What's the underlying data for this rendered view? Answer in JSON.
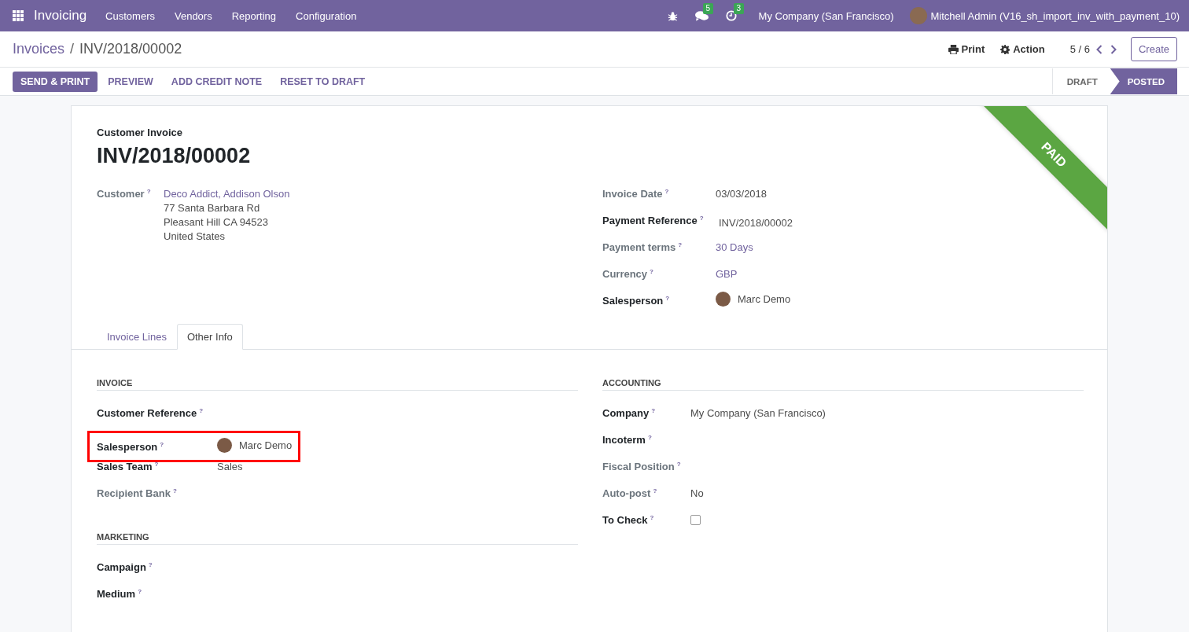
{
  "navbar": {
    "app": "Invoicing",
    "menu": [
      "Customers",
      "Vendors",
      "Reporting",
      "Configuration"
    ],
    "messages_count": "5",
    "activities_count": "3",
    "company": "My Company (San Francisco)",
    "user": "Mitchell Admin (V16_sh_import_inv_with_payment_10)"
  },
  "breadcrumb": {
    "parent": "Invoices",
    "separator": "/",
    "current": "INV/2018/00002"
  },
  "toolbar": {
    "print": "Print",
    "action": "Action",
    "pager": "5 / 6",
    "create": "Create"
  },
  "buttons": [
    {
      "label": "SEND & PRINT",
      "primary": true
    },
    {
      "label": "PREVIEW",
      "primary": false
    },
    {
      "label": "ADD CREDIT NOTE",
      "primary": false
    },
    {
      "label": "RESET TO DRAFT",
      "primary": false
    }
  ],
  "status_steps": [
    {
      "label": "DRAFT",
      "selected": false
    },
    {
      "label": "POSTED",
      "selected": true
    }
  ],
  "ribbon": "PAID",
  "form": {
    "subtitle": "Customer Invoice",
    "title": "INV/2018/00002",
    "left_fields": [
      {
        "label": "Customer",
        "help": "?",
        "required": false,
        "kind": "partner",
        "value": "Deco Addict, Addison Olson",
        "address": [
          "77 Santa Barbara Rd",
          "Pleasant Hill CA 94523",
          "United States"
        ]
      }
    ],
    "right_fields": [
      {
        "label": "Invoice Date",
        "help": "?",
        "required": false,
        "kind": "text",
        "value": "03/03/2018"
      },
      {
        "label": "Payment Reference",
        "help": "?",
        "required": true,
        "kind": "input",
        "value": "INV/2018/00002"
      },
      {
        "label": "Payment terms",
        "help": "?",
        "required": false,
        "kind": "link",
        "value": "30 Days"
      },
      {
        "label": "Currency",
        "help": "?",
        "required": false,
        "kind": "link",
        "value": "GBP"
      },
      {
        "label": "Salesperson",
        "help": "?",
        "required": true,
        "kind": "avatar",
        "value": "Marc Demo"
      }
    ]
  },
  "tabs": [
    {
      "label": "Invoice Lines",
      "selected": false
    },
    {
      "label": "Other Info",
      "selected": true
    }
  ],
  "sections_left": [
    {
      "title": "INVOICE",
      "fields": [
        {
          "label": "Customer Reference",
          "help": "?",
          "required": true,
          "kind": "empty"
        },
        {
          "label": "Salesperson",
          "help": "?",
          "required": true,
          "kind": "avatar",
          "value": "Marc Demo",
          "highlighted": true
        },
        {
          "label": "Sales Team",
          "help": "?",
          "required": true,
          "kind": "text",
          "value": "Sales"
        },
        {
          "label": "Recipient Bank",
          "help": "?",
          "required": false,
          "kind": "empty"
        }
      ]
    },
    {
      "title": "MARKETING",
      "fields": [
        {
          "label": "Campaign",
          "help": "?",
          "required": true,
          "kind": "empty"
        },
        {
          "label": "Medium",
          "help": "?",
          "required": true,
          "kind": "empty"
        }
      ]
    }
  ],
  "sections_right": [
    {
      "title": "ACCOUNTING",
      "fields": [
        {
          "label": "Company",
          "help": "?",
          "required": true,
          "kind": "text",
          "value": "My Company (San Francisco)"
        },
        {
          "label": "Incoterm",
          "help": "?",
          "required": true,
          "kind": "empty"
        },
        {
          "label": "Fiscal Position",
          "help": "?",
          "required": false,
          "kind": "empty"
        },
        {
          "label": "Auto-post",
          "help": "?",
          "required": false,
          "kind": "text",
          "value": "No"
        },
        {
          "label": "To Check",
          "help": "?",
          "required": true,
          "kind": "checkbox",
          "checked": false
        }
      ]
    }
  ]
}
